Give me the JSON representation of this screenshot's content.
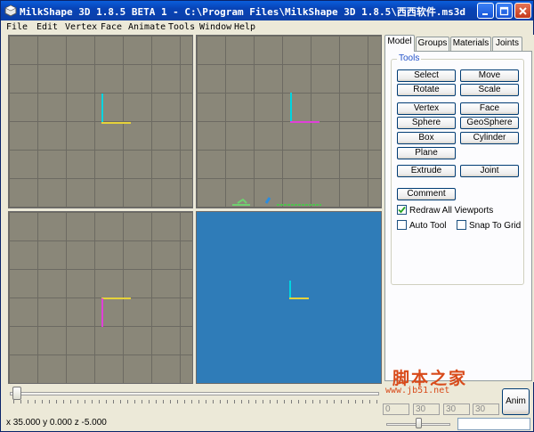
{
  "window": {
    "title": "MilkShape 3D 1.8.5 BETA 1 - C:\\Program Files\\MilkShape 3D 1.8.5\\西西软件.ms3d"
  },
  "menu": [
    "File",
    "Edit",
    "Vertex",
    "Face",
    "Animate",
    "Tools",
    "Window",
    "Help"
  ],
  "panel": {
    "tabs": [
      "Model",
      "Groups",
      "Materials",
      "Joints"
    ],
    "group_title": "Tools",
    "buttons": {
      "select": "Select",
      "move": "Move",
      "rotate": "Rotate",
      "scale": "Scale",
      "vertex": "Vertex",
      "face": "Face",
      "sphere": "Sphere",
      "geosphere": "GeoSphere",
      "box": "Box",
      "cylinder": "Cylinder",
      "plane": "Plane",
      "extrude": "Extrude",
      "joint": "Joint",
      "comment": "Comment"
    },
    "checkboxes": {
      "redraw_all": {
        "label": "Redraw All Viewports",
        "checked": true
      },
      "auto_tool": {
        "label": "Auto Tool",
        "checked": false
      },
      "snap_to_grid": {
        "label": "Snap To Grid",
        "checked": false
      }
    }
  },
  "status": {
    "coords": "x 35.000 y 0.000 z -5.000"
  },
  "frames": [
    "0",
    "30",
    "30",
    "30"
  ],
  "anim_button": "Anim",
  "watermark": {
    "text": "脚本之家",
    "url": "www.jb51.net"
  },
  "colors": {
    "viewport_gray": "#8a8779",
    "viewport_blue": "#2f7cb8",
    "title_blue": "#0843b6"
  }
}
